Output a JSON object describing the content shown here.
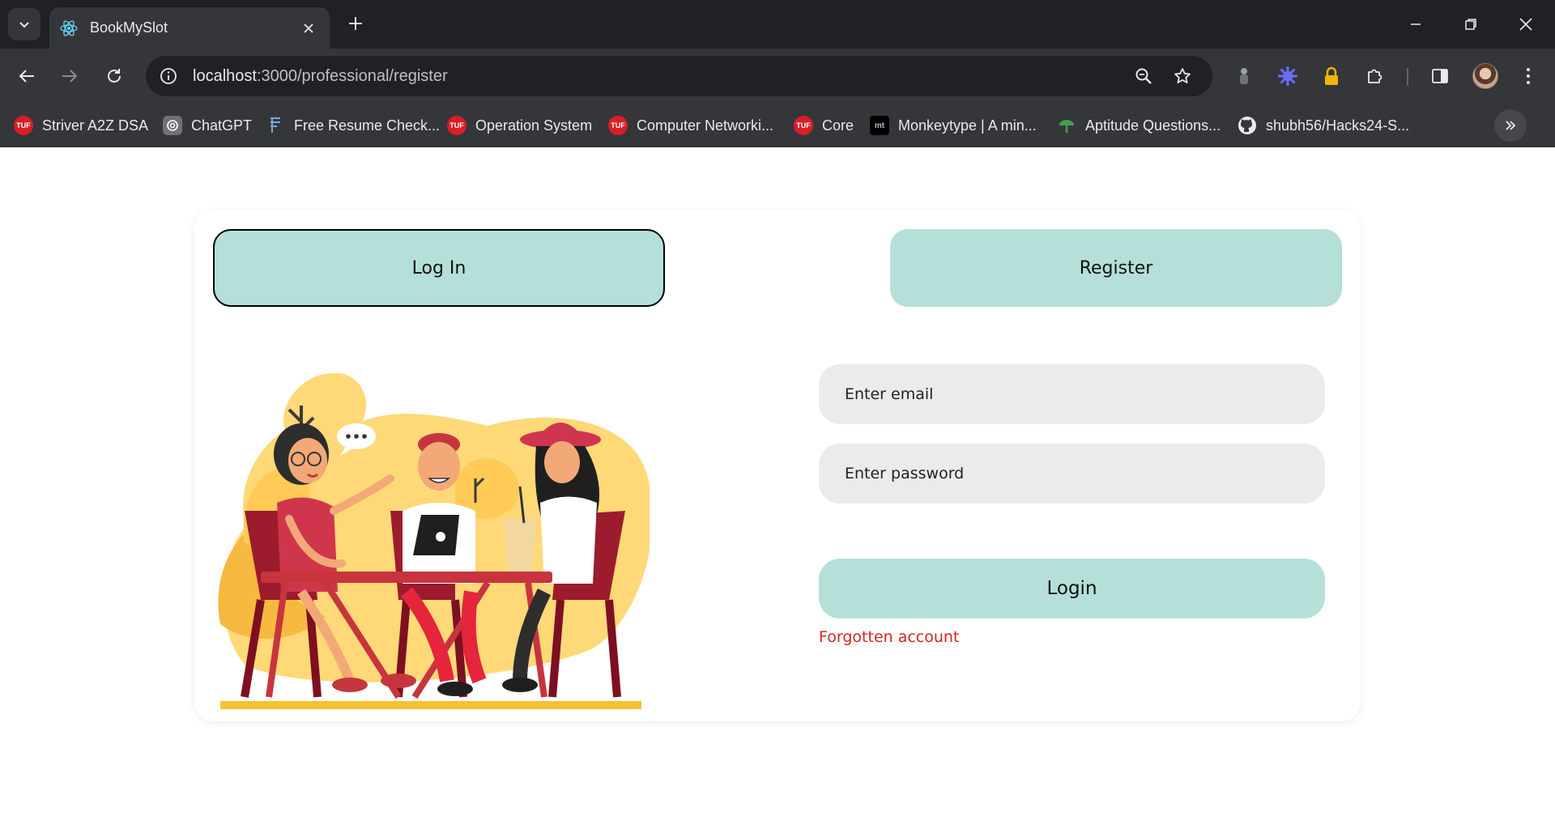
{
  "browser": {
    "tab": {
      "title": "BookMySlot",
      "favicon": "react-icon"
    },
    "url": {
      "host": "localhost",
      "path": ":3000/professional/register"
    },
    "bookmarks": [
      {
        "label": "Striver A2Z DSA",
        "icon": "tuf-icon"
      },
      {
        "label": "ChatGPT",
        "icon": "chatgpt-icon"
      },
      {
        "label": "Free Resume Check...",
        "icon": "resume-icon"
      },
      {
        "label": "Operation System",
        "icon": "tuf-icon"
      },
      {
        "label": "Computer Networki...",
        "icon": "tuf-icon"
      },
      {
        "label": "Core",
        "icon": "tuf-icon"
      },
      {
        "label": "Monkeytype | A min...",
        "icon": "monkeytype-icon"
      },
      {
        "label": "Aptitude Questions...",
        "icon": "indiabix-icon"
      },
      {
        "label": "shubh56/Hacks24-S...",
        "icon": "github-icon"
      }
    ],
    "tuf_badge": "TUF",
    "mt_badge": "mt"
  },
  "page": {
    "login_tab": "Log In",
    "register_tab": "Register",
    "email_placeholder": "Enter email",
    "password_placeholder": "Enter password",
    "login_button": "Login",
    "forgot_link": "Forgotten account"
  },
  "colors": {
    "accent": "#b5dfd9",
    "field_bg": "#ebebeb",
    "link": "#d0271d"
  }
}
